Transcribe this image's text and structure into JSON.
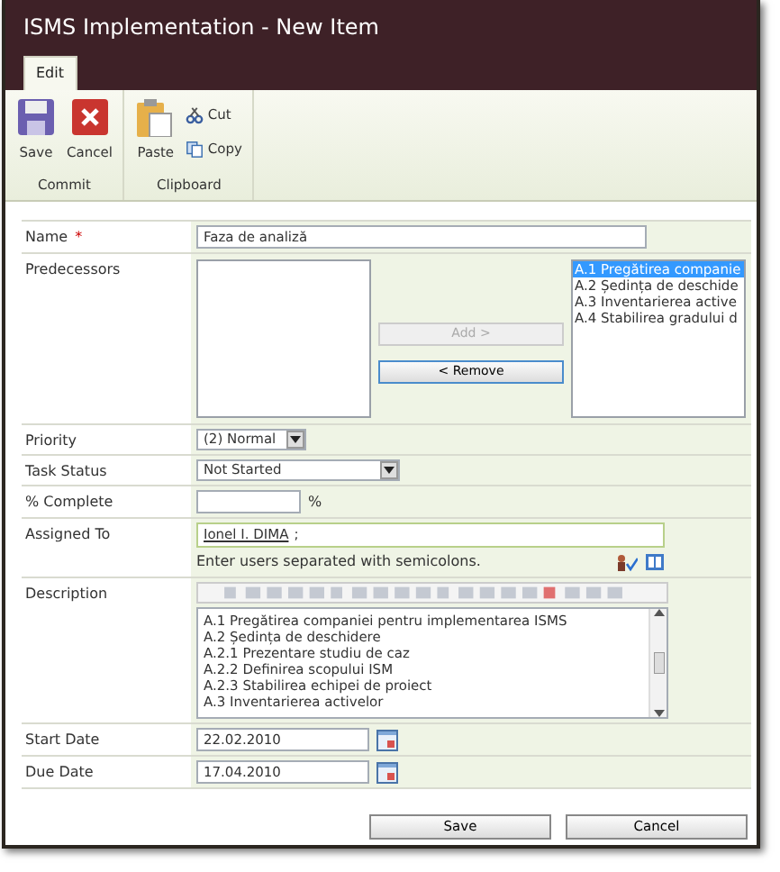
{
  "window": {
    "title": "ISMS Implementation - New Item"
  },
  "ribbon": {
    "tabs": [
      {
        "label": "Edit",
        "selected": true
      }
    ],
    "groups": [
      {
        "name": "Commit",
        "buttons": [
          {
            "label": "Save",
            "kind": "save"
          },
          {
            "label": "Cancel",
            "kind": "cancel"
          }
        ]
      },
      {
        "name": "Clipboard",
        "buttons": [
          {
            "label": "Paste",
            "kind": "paste"
          }
        ],
        "small_buttons": [
          {
            "label": "Cut",
            "kind": "cut"
          },
          {
            "label": "Copy",
            "kind": "copy"
          }
        ]
      }
    ]
  },
  "fields": [
    {
      "kind": "text",
      "label": "Name",
      "required_mark": "*",
      "value": "Faza de analiză"
    },
    {
      "kind": "predecessors",
      "label": "Predecessors",
      "add_button": {
        "label": "Add >",
        "disabled": true
      },
      "remove_button": {
        "label": "< Remove",
        "disabled": false
      },
      "selected_items": [
        {
          "text": "A.1 Pregătirea companie",
          "selected": true
        },
        {
          "text": "A.2 Ședința de deschide",
          "selected": false
        },
        {
          "text": "A.3 Inventarierea active",
          "selected": false
        },
        {
          "text": "A.4 Stabilirea gradului d",
          "selected": false
        }
      ]
    },
    {
      "kind": "compact-select",
      "label": "Priority",
      "value": "(2) Normal"
    },
    {
      "kind": "select",
      "label": "Task Status",
      "value": "Not Started"
    },
    {
      "kind": "percent",
      "label": "% Complete",
      "suffix": "%"
    },
    {
      "kind": "people",
      "label": "Assigned To",
      "person": "Ionel I. DIMA",
      "separator": ";",
      "hint": "Enter users separated with semicolons."
    },
    {
      "kind": "richtext",
      "label": "Description",
      "lines": [
        "A.1 Pregătirea companiei pentru implementarea ISMS",
        "A.2 Ședința de deschidere",
        "A.2.1 Prezentare studiu de caz",
        "A.2.2 Definirea scopului ISM",
        "A.2.3 Stabilirea echipei de proiect",
        "A.3 Inventarierea activelor"
      ]
    },
    {
      "kind": "date",
      "label": "Start Date",
      "value": "22.02.2010"
    },
    {
      "kind": "date",
      "label": "Due Date",
      "value": "17.04.2010"
    }
  ],
  "buttons": [
    "Save",
    "Cancel"
  ]
}
